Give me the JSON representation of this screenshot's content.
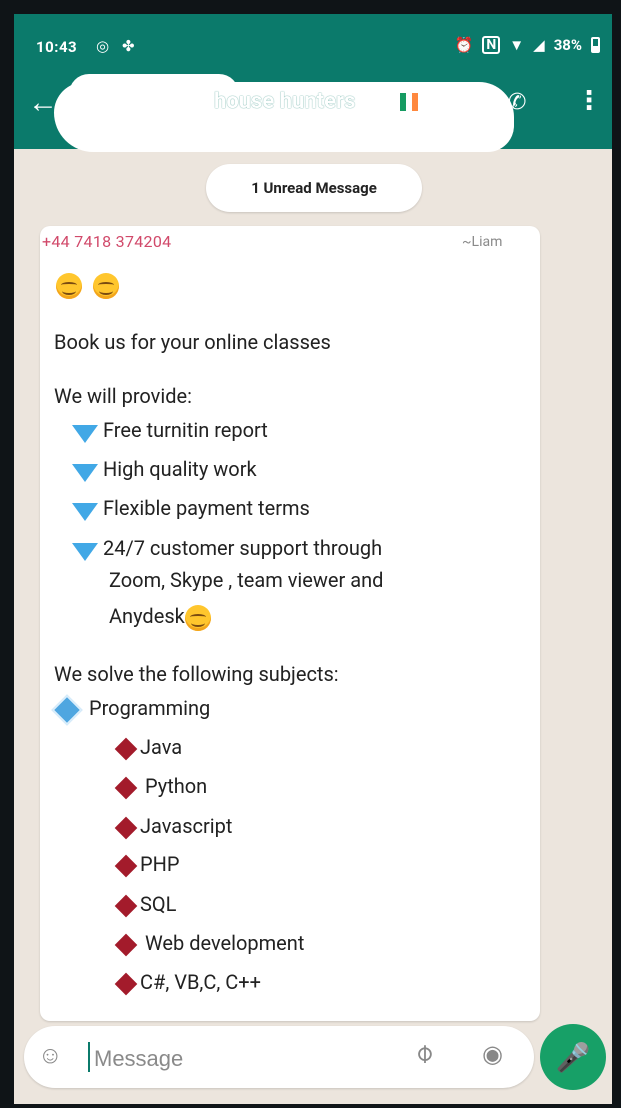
{
  "status": {
    "time": "10:43",
    "battery": "38%",
    "icons": [
      "instagram-icon",
      "pinwheel-icon",
      "alarm-icon",
      "nfc-icon",
      "wifi-icon",
      "signal-icon",
      "battery-icon"
    ]
  },
  "header": {
    "title": "house hunters",
    "flag_colors": [
      "#169b62",
      "#ffffff",
      "#ff883e"
    ],
    "icons": [
      "back-arrow-icon",
      "add-call-icon",
      "more-vert-icon"
    ]
  },
  "unread_badge": "1 Unread Message",
  "message": {
    "sender_phone": "+44 7418 374204",
    "sender_name": "~Liam",
    "intro": "Book us for your online classes",
    "provide_heading": "We will provide:",
    "provide_items": [
      "Free turnitin report",
      "High quality work",
      "Flexible payment terms"
    ],
    "support_lines": [
      "24/7 customer support through",
      "Zoom, Skype , team viewer and",
      "Anydesk"
    ],
    "subjects_heading": "We solve the following subjects:",
    "category": "Programming",
    "subjects": [
      "Java",
      " Python",
      "Javascript",
      "PHP",
      "SQL",
      " Web development",
      "C#, VB,C, C++"
    ]
  },
  "composer": {
    "placeholder": "Message"
  },
  "colors": {
    "header_bg": "#0b7a6b",
    "sender": "#d1496a",
    "mic_bg": "#17a067"
  }
}
